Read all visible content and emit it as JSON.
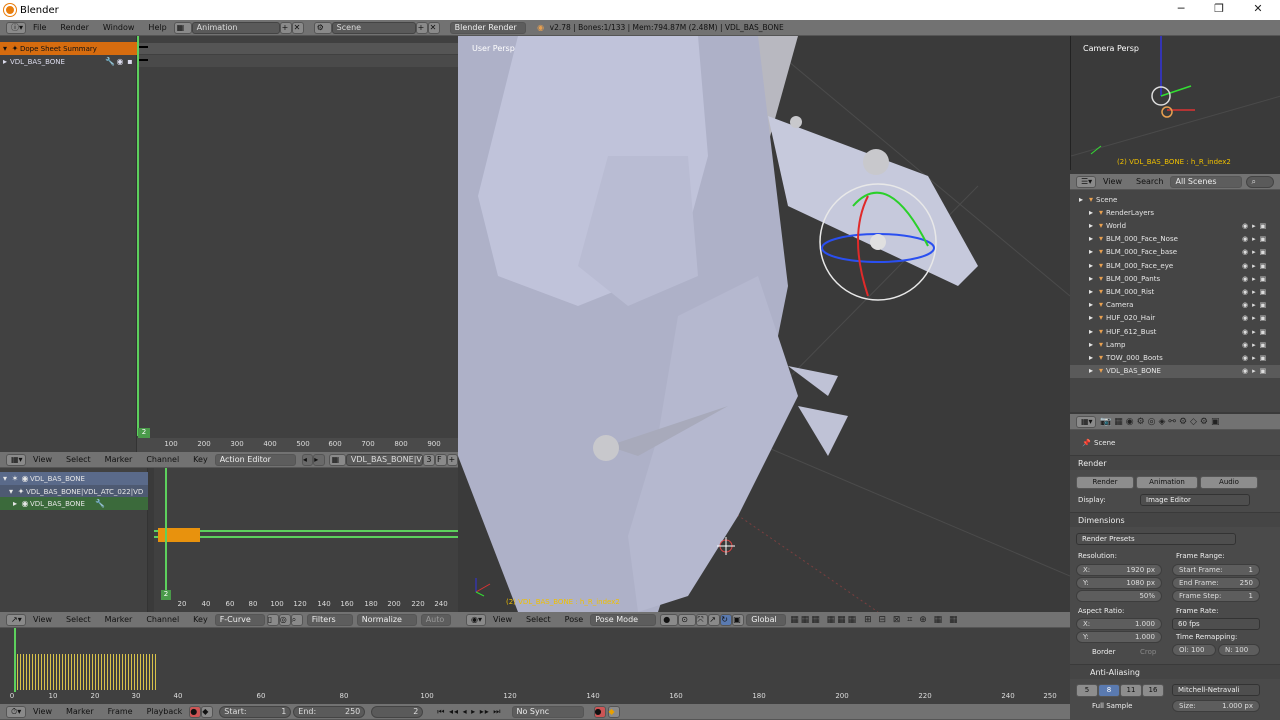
{
  "window": {
    "title": "Blender",
    "minimize": "─",
    "maximize": "❐",
    "close": "✕"
  },
  "topbar": {
    "menus": [
      "File",
      "Render",
      "Window",
      "Help"
    ],
    "layout": "Animation",
    "scene": "Scene",
    "engine": "Blender Render",
    "info": "v2.78 | Bones:1/133 | Mem:794.87M (2.48M) | VDL_BAS_BONE"
  },
  "dopesheet": {
    "rows": [
      "Dope Sheet Summary",
      "VDL_BAS_BONE"
    ],
    "current_frame": "2",
    "ruler": [
      "100",
      "200",
      "300",
      "400",
      "500",
      "600",
      "700",
      "800",
      "900"
    ],
    "header": {
      "menus": [
        "View",
        "Select",
        "Marker",
        "Channel",
        "Key"
      ],
      "mode": "Action Editor",
      "action": "VDL_BAS_BONE|VD...",
      "users": "3"
    }
  },
  "action_editor": {
    "rows": [
      "VDL_BAS_BONE",
      "VDL_BAS_BONE|VDL_ATC_022|VD",
      "VDL_BAS_BONE"
    ],
    "current_frame": "2",
    "ruler": [
      "20",
      "40",
      "60",
      "80",
      "100",
      "120",
      "140",
      "160",
      "180",
      "200",
      "220",
      "240"
    ]
  },
  "graph_editor": {
    "header": {
      "menus": [
        "View",
        "Select",
        "Marker",
        "Channel",
        "Key"
      ],
      "mode": "F-Curve",
      "filters": "Filters",
      "normalize": "Normalize",
      "auto": "Auto"
    },
    "ruler": [
      "0",
      "10",
      "20",
      "30",
      "40",
      "60",
      "80",
      "100",
      "120",
      "140",
      "160",
      "180",
      "200",
      "220",
      "240",
      "250"
    ]
  },
  "timeline": {
    "menus": [
      "View",
      "Marker",
      "Frame",
      "Playback"
    ],
    "start_label": "Start:",
    "start": "1",
    "end_label": "End:",
    "end": "250",
    "current": "2",
    "sync": "No Sync"
  },
  "viewport": {
    "label": "User Persp",
    "object_label": "(2) VDL_BAS_BONE : h_R_index2",
    "header": {
      "menus": [
        "View",
        "Select",
        "Pose"
      ],
      "mode": "Pose Mode",
      "orientation": "Global"
    }
  },
  "camera_view": {
    "label": "Camera Persp",
    "object_label": "(2) VDL_BAS_BONE : h_R_index2"
  },
  "outliner": {
    "header": {
      "view": "View",
      "search": "Search",
      "scope": "All Scenes"
    },
    "items": [
      {
        "label": "Scene",
        "level": 0
      },
      {
        "label": "RenderLayers",
        "level": 1
      },
      {
        "label": "World",
        "level": 1
      },
      {
        "label": "BLM_000_Face_Nose",
        "level": 1
      },
      {
        "label": "BLM_000_Face_base",
        "level": 1
      },
      {
        "label": "BLM_000_Face_eye",
        "level": 1
      },
      {
        "label": "BLM_000_Pants",
        "level": 1
      },
      {
        "label": "BLM_000_Rist",
        "level": 1
      },
      {
        "label": "Camera",
        "level": 1
      },
      {
        "label": "HUF_020_Hair",
        "level": 1
      },
      {
        "label": "HUF_612_Bust",
        "level": 1
      },
      {
        "label": "Lamp",
        "level": 1
      },
      {
        "label": "TOW_000_Boots",
        "level": 1
      },
      {
        "label": "VDL_BAS_BONE",
        "level": 1
      }
    ]
  },
  "properties": {
    "scene": "Scene",
    "render_panel": "Render",
    "buttons": [
      "Render",
      "Animation",
      "Audio"
    ],
    "display_label": "Display:",
    "display": "Image Editor",
    "dimensions_panel": "Dimensions",
    "presets": "Render Presets",
    "resolution_label": "Resolution:",
    "res_x_label": "X:",
    "res_x": "1920 px",
    "res_y_label": "Y:",
    "res_y": "1080 px",
    "res_pct": "50%",
    "frame_range_label": "Frame Range:",
    "start_frame_label": "Start Frame:",
    "start_frame": "1",
    "end_frame_label": "End Frame:",
    "end_frame": "250",
    "frame_step_label": "Frame Step:",
    "frame_step": "1",
    "aspect_label": "Aspect Ratio:",
    "aspect_x": "1.000",
    "aspect_y": "1.000",
    "frame_rate_label": "Frame Rate:",
    "frame_rate": "60 fps",
    "border": "Border",
    "crop": "Crop",
    "time_remap_label": "Time Remapping:",
    "old": "Ol: 100",
    "new": "N: 100",
    "aa_panel": "Anti-Aliasing",
    "aa_samples": [
      "5",
      "8",
      "11",
      "16"
    ],
    "aa_filter": "Mitchell-Netravali",
    "full_sample": "Full Sample",
    "size_label": "Size:",
    "size": "1.000 px"
  }
}
